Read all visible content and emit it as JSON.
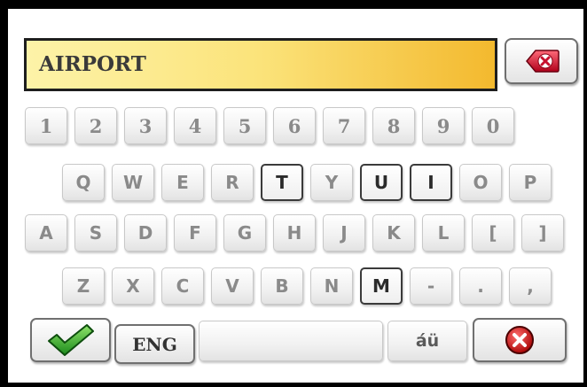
{
  "search": {
    "value": "AIRPORT"
  },
  "keyboard": {
    "rows": [
      {
        "type": "num",
        "keys": [
          {
            "label": "1",
            "hl": false
          },
          {
            "label": "2",
            "hl": false
          },
          {
            "label": "3",
            "hl": false
          },
          {
            "label": "4",
            "hl": false
          },
          {
            "label": "5",
            "hl": false
          },
          {
            "label": "6",
            "hl": false
          },
          {
            "label": "7",
            "hl": false
          },
          {
            "label": "8",
            "hl": false
          },
          {
            "label": "9",
            "hl": false
          },
          {
            "label": "0",
            "hl": false
          }
        ]
      },
      {
        "type": "alpha",
        "keys": [
          {
            "label": "Q",
            "hl": false
          },
          {
            "label": "W",
            "hl": false
          },
          {
            "label": "E",
            "hl": false
          },
          {
            "label": "R",
            "hl": false
          },
          {
            "label": "T",
            "hl": true
          },
          {
            "label": "Y",
            "hl": false
          },
          {
            "label": "U",
            "hl": true
          },
          {
            "label": "I",
            "hl": true
          },
          {
            "label": "O",
            "hl": false
          },
          {
            "label": "P",
            "hl": false
          }
        ]
      },
      {
        "type": "alpha",
        "keys": [
          {
            "label": "A",
            "hl": false
          },
          {
            "label": "S",
            "hl": false
          },
          {
            "label": "D",
            "hl": false
          },
          {
            "label": "F",
            "hl": false
          },
          {
            "label": "G",
            "hl": false
          },
          {
            "label": "H",
            "hl": false
          },
          {
            "label": "J",
            "hl": false
          },
          {
            "label": "K",
            "hl": false
          },
          {
            "label": "L",
            "hl": false
          },
          {
            "label": "[",
            "hl": false
          },
          {
            "label": "]",
            "hl": false
          }
        ]
      },
      {
        "type": "alpha",
        "keys": [
          {
            "label": "Z",
            "hl": false
          },
          {
            "label": "X",
            "hl": false
          },
          {
            "label": "C",
            "hl": false
          },
          {
            "label": "V",
            "hl": false
          },
          {
            "label": "B",
            "hl": false
          },
          {
            "label": "N",
            "hl": false
          },
          {
            "label": "M",
            "hl": true
          },
          {
            "label": "-",
            "hl": false
          },
          {
            "label": ".",
            "hl": false
          },
          {
            "label": ",",
            "hl": false
          }
        ]
      }
    ]
  },
  "bottom": {
    "language_label": "ENG",
    "special_chars_label": "áü"
  },
  "colors": {
    "field_left": "#fdf3a8",
    "field_right": "#f3b92e",
    "confirm_green": "#2fa82f",
    "cancel_red": "#d01a1a",
    "backspace_red": "#c8102e"
  },
  "icons": {
    "backspace": "backspace-icon",
    "confirm": "checkmark-icon",
    "cancel": "cancel-x-icon"
  }
}
